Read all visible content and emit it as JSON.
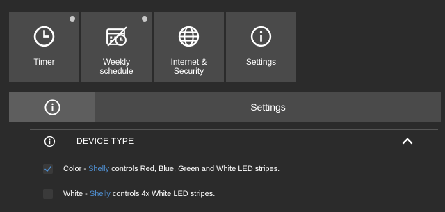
{
  "tiles": [
    {
      "label": "Timer",
      "icon": "clock-icon",
      "has_dot": true
    },
    {
      "label": "Weekly\nschedule",
      "icon": "weekly-schedule-icon",
      "has_dot": true
    },
    {
      "label": "Internet &\nSecurity",
      "icon": "globe-icon",
      "has_dot": false
    },
    {
      "label": "Settings",
      "icon": "info-icon",
      "has_dot": false
    }
  ],
  "tabbar": {
    "title": "Settings",
    "icon": "info-icon"
  },
  "section": {
    "title": "DEVICE TYPE",
    "icon": "info-icon",
    "chevron": "chevron-up-icon",
    "expanded": true
  },
  "options": [
    {
      "checked": true,
      "label_prefix": "Color - ",
      "brand": "Shelly",
      "label_suffix": " controls Red, Blue, Green and White LED stripes."
    },
    {
      "checked": false,
      "label_prefix": "White - ",
      "brand": "Shelly",
      "label_suffix": " controls 4x White LED stripes."
    }
  ],
  "colors": {
    "background": "#2b2b2b",
    "tile": "#4a4a4a",
    "tab_active": "#5e5e5e",
    "brand_link": "#4f8fd1",
    "dot": "#c9c9c9"
  }
}
